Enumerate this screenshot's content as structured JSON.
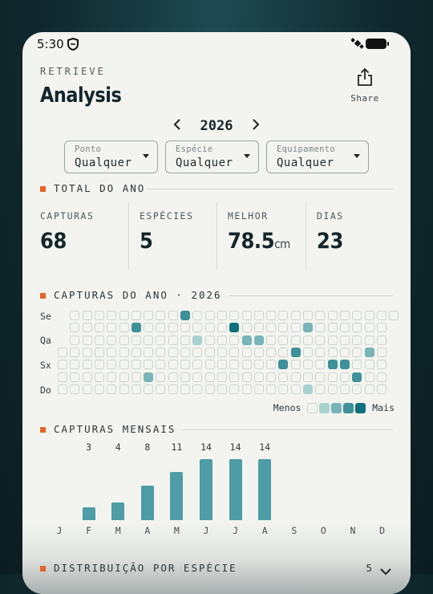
{
  "status_bar": {
    "time": "5:30"
  },
  "header": {
    "eyebrow": "RETRIEVE",
    "title": "Analysis",
    "share_label": "Share"
  },
  "year_nav": {
    "prev": "‹",
    "year": "2026",
    "next": "›"
  },
  "filters": [
    {
      "label": "Ponto",
      "value": "Qualquer"
    },
    {
      "label": "Espécie",
      "value": "Qualquer"
    },
    {
      "label": "Equipamento",
      "value": "Qualquer"
    }
  ],
  "total_section": {
    "title": "TOTAL DO ANO"
  },
  "stats": [
    {
      "label": "CAPTURAS",
      "value": "68",
      "unit": ""
    },
    {
      "label": "ESPÉCIES",
      "value": "5",
      "unit": ""
    },
    {
      "label": "MELHOR",
      "value": "78.5",
      "unit": "cm"
    },
    {
      "label": "DIAS",
      "value": "23",
      "unit": ""
    }
  ],
  "heatmap_section": {
    "title": "CAPTURAS DO ANO · 2026"
  },
  "heatmap": {
    "day_labels": [
      "Se",
      "Qa",
      "Sx",
      "Do"
    ],
    "legend_less": "Menos",
    "legend_more": "Mais",
    "colors": [
      "#f3f4ef",
      "#a9d1d0",
      "#79b4b9",
      "#3f9199",
      "#0f6f7c"
    ],
    "active": [
      {
        "col": 10,
        "row": 0,
        "level": 3
      },
      {
        "col": 6,
        "row": 1,
        "level": 3
      },
      {
        "col": 14,
        "row": 1,
        "level": 4
      },
      {
        "col": 20,
        "row": 1,
        "level": 2
      },
      {
        "col": 11,
        "row": 2,
        "level": 1
      },
      {
        "col": 15,
        "row": 2,
        "level": 2
      },
      {
        "col": 16,
        "row": 2,
        "level": 2
      },
      {
        "col": 19,
        "row": 3,
        "level": 3
      },
      {
        "col": 25,
        "row": 3,
        "level": 2
      },
      {
        "col": 18,
        "row": 4,
        "level": 3
      },
      {
        "col": 22,
        "row": 4,
        "level": 3
      },
      {
        "col": 23,
        "row": 4,
        "level": 3
      },
      {
        "col": 7,
        "row": 5,
        "level": 2
      },
      {
        "col": 24,
        "row": 5,
        "level": 3
      },
      {
        "col": 20,
        "row": 6,
        "level": 1
      }
    ]
  },
  "monthly_section": {
    "title": "CAPTURAS MENSAIS"
  },
  "chart_data": {
    "type": "bar",
    "categories": [
      "J",
      "F",
      "M",
      "A",
      "M",
      "J",
      "J",
      "A",
      "S",
      "O",
      "N",
      "D"
    ],
    "values": [
      0,
      3,
      4,
      8,
      11,
      14,
      14,
      14,
      0,
      0,
      0,
      0
    ],
    "value_labels": [
      "",
      "3",
      "4",
      "8",
      "11",
      "14",
      "14",
      "14",
      "",
      "",
      "",
      ""
    ],
    "ylim": [
      0,
      14
    ]
  },
  "species_section": {
    "title": "DISTRIBUIÇÃO POR ESPÉCIE",
    "count": "5"
  }
}
